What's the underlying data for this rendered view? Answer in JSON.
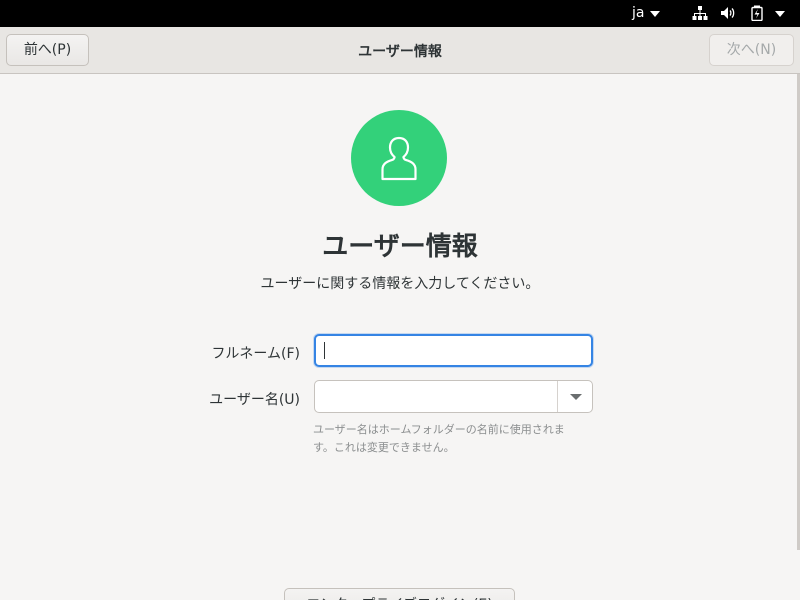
{
  "topbar": {
    "language": "ja",
    "icons": [
      "language-caret-icon",
      "network-wired-icon",
      "volume-icon",
      "battery-icon",
      "system-menu-caret-icon"
    ]
  },
  "header": {
    "prev_label": "前へ(P)",
    "title": "ユーザー情報",
    "next_label": "次へ(N)"
  },
  "main": {
    "avatar_icon": "user-avatar-icon",
    "accent_color": "#33d17a",
    "title": "ユーザー情報",
    "subtitle": "ユーザーに関する情報を入力してください。",
    "fullname_label": "フルネーム(F)",
    "fullname_value": "",
    "username_label": "ユーザー名(U)",
    "username_value": "",
    "hint_line1": "ユーザー名はホームフォルダーの名前に使用されま",
    "hint_line2": "す。これは変更できません。",
    "bottom_button_label": "エンタープライズログイン(E)"
  }
}
